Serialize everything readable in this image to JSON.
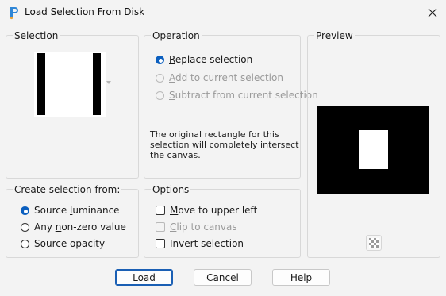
{
  "window": {
    "title": "Load Selection From Disk",
    "icon": "paintshop-app-icon",
    "close_icon": "close-icon"
  },
  "selection_group": {
    "label": "Selection",
    "dropdown_icon": "chevron-down-icon"
  },
  "operation_group": {
    "label": "Operation",
    "options": [
      {
        "label_pre": "",
        "label_key": "R",
        "label_post": "eplace selection",
        "checked": true,
        "enabled": true
      },
      {
        "label_pre": "",
        "label_key": "A",
        "label_post": "dd to current selection",
        "checked": false,
        "enabled": false
      },
      {
        "label_pre": "",
        "label_key": "S",
        "label_post": "ubtract from current selection",
        "checked": false,
        "enabled": false
      }
    ],
    "info_lines": [
      "The original rectangle for this",
      "selection will completely intersect",
      "the canvas."
    ]
  },
  "preview_group": {
    "label": "Preview",
    "checker_icon": "checkerboard-icon"
  },
  "create_group": {
    "label": "Create selection from:",
    "options": [
      {
        "label_pre": "Source ",
        "label_key": "l",
        "label_post": "uminance",
        "checked": true
      },
      {
        "label_pre": "Any ",
        "label_key": "n",
        "label_post": "on-zero value",
        "checked": false
      },
      {
        "label_pre": "S",
        "label_key": "o",
        "label_post": "urce opacity",
        "checked": false
      }
    ]
  },
  "options_group": {
    "label": "Options",
    "checks": [
      {
        "label_pre": "",
        "label_key": "M",
        "label_post": "ove to upper left",
        "checked": false,
        "enabled": true
      },
      {
        "label_pre": "",
        "label_key": "C",
        "label_post": "lip to canvas",
        "checked": false,
        "enabled": false
      },
      {
        "label_pre": "",
        "label_key": "I",
        "label_post": "nvert selection",
        "checked": false,
        "enabled": true
      }
    ]
  },
  "buttons": {
    "load": "Load",
    "cancel": "Cancel",
    "help": "Help"
  }
}
